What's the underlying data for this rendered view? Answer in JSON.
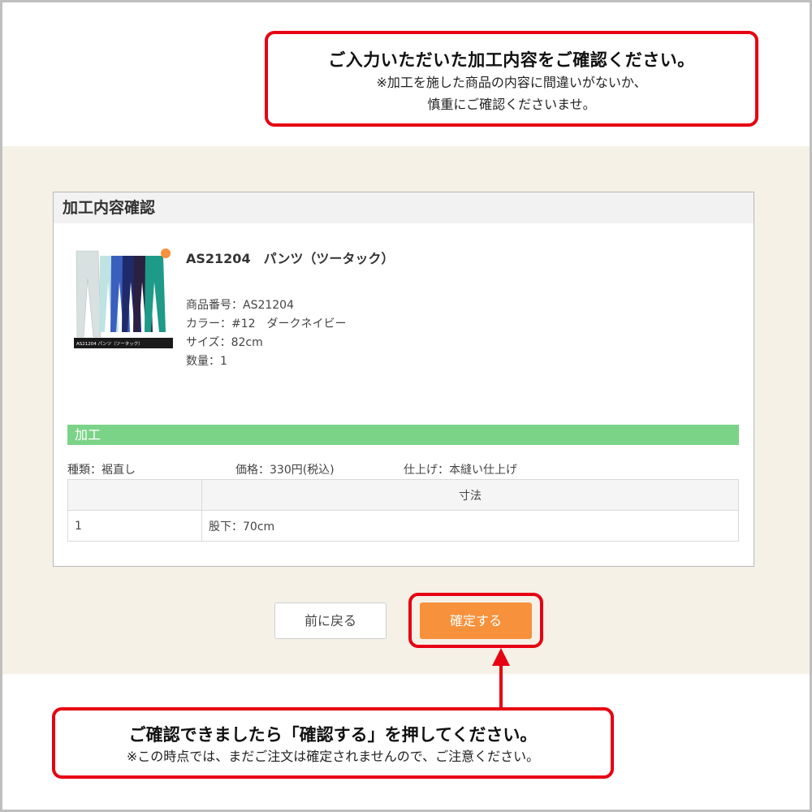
{
  "top_callout": {
    "title": "ご入力いただいた加工内容をご確認ください。",
    "line1": "※加工を施した商品の内容に間違いがないか、",
    "line2": "慎重にご確認くださいませ。"
  },
  "panel": {
    "title": "加工内容確認",
    "product_name": "AS21204　パンツ（ツータック）",
    "product_image_caption": "AS21204 パンツ（ツータック）",
    "product_number": "商品番号：AS21204",
    "color": "カラー：#12　ダークネイビー",
    "size": "サイズ：82cm",
    "quantity": "数量：1",
    "processing_header": "加工",
    "type": "種類：裾直し",
    "price": "価格：330円(税込)",
    "finish": "仕上げ：本縫い仕上げ",
    "table": {
      "header": "寸法",
      "rows": [
        {
          "no": "1",
          "value": "股下：70cm"
        }
      ]
    }
  },
  "buttons": {
    "back": "前に戻る",
    "confirm": "確定する"
  },
  "bottom_callout": {
    "title": "ご確認できましたら「確認する」を押してください。",
    "line": "※この時点では、まだご注文は確定されませんので、ご注意ください。"
  },
  "colors": {
    "accent_red": "#e60012",
    "confirm_orange": "#f7913c",
    "processing_green": "#7bd388",
    "background_beige": "#f5f1e7"
  },
  "icons": [
    "product-thumbnail"
  ]
}
